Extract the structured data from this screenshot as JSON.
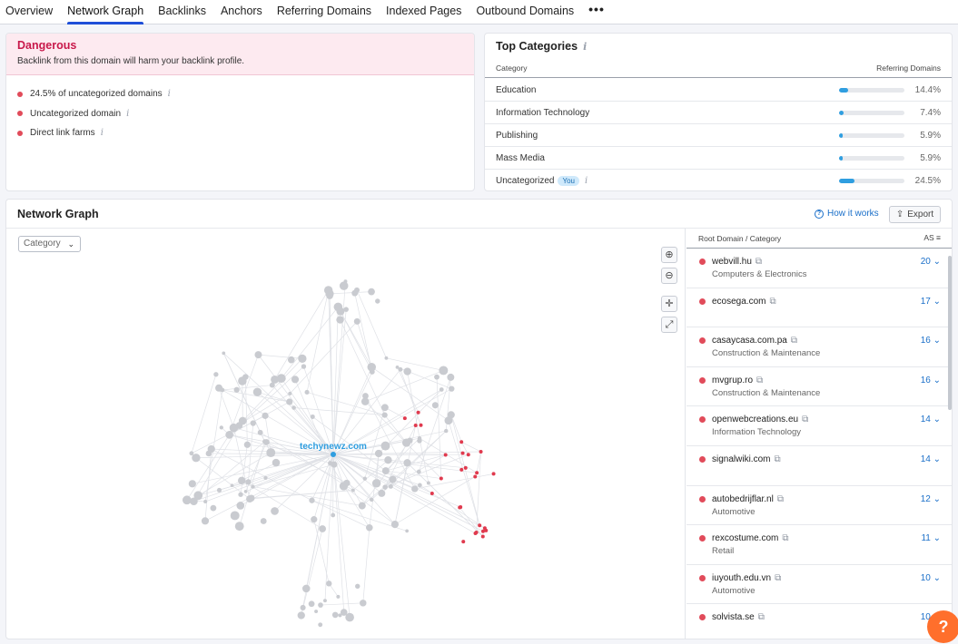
{
  "tabs": [
    {
      "label": "Overview"
    },
    {
      "label": "Network Graph",
      "active": true
    },
    {
      "label": "Backlinks"
    },
    {
      "label": "Anchors"
    },
    {
      "label": "Referring Domains"
    },
    {
      "label": "Indexed Pages"
    },
    {
      "label": "Outbound Domains"
    }
  ],
  "tabs_more": "•••",
  "danger": {
    "title": "Dangerous",
    "subtitle": "Backlink from this domain will harm your backlink profile.",
    "items": [
      {
        "label": "24.5% of uncategorized domains"
      },
      {
        "label": "Uncategorized domain"
      },
      {
        "label": "Direct link farms"
      }
    ]
  },
  "top_categories": {
    "title": "Top Categories",
    "col_category": "Category",
    "col_domains": "Referring Domains",
    "you_badge": "You",
    "rows": [
      {
        "name": "Education",
        "pct": "14.4%",
        "value": 14.4
      },
      {
        "name": "Information Technology",
        "pct": "7.4%",
        "value": 7.4
      },
      {
        "name": "Publishing",
        "pct": "5.9%",
        "value": 5.9
      },
      {
        "name": "Mass Media",
        "pct": "5.9%",
        "value": 5.9
      },
      {
        "name": "Uncategorized",
        "pct": "24.5%",
        "value": 24.5,
        "you": true
      }
    ]
  },
  "network": {
    "title": "Network Graph",
    "how_it_works": "How it works",
    "export": "Export",
    "category_select": "Category",
    "center_label": "techynewz.com",
    "colors": {
      "node": "#c9cbd0",
      "risky": "#e03a4e",
      "edge": "#dfe1e6",
      "center": "#2f9ee0"
    }
  },
  "domain_list": {
    "col_domain": "Root Domain / Category",
    "col_as": "AS",
    "rows": [
      {
        "domain": "webvill.hu",
        "category": "Computers & Electronics",
        "as": "20"
      },
      {
        "domain": "ecosega.com",
        "category": "",
        "as": "17"
      },
      {
        "domain": "casaycasa.com.pa",
        "category": "Construction & Maintenance",
        "as": "16"
      },
      {
        "domain": "mvgrup.ro",
        "category": "Construction & Maintenance",
        "as": "16"
      },
      {
        "domain": "openwebcreations.eu",
        "category": "Information Technology",
        "as": "14"
      },
      {
        "domain": "signalwiki.com",
        "category": "",
        "as": "14"
      },
      {
        "domain": "autobedrijflar.nl",
        "category": "Automotive",
        "as": "12"
      },
      {
        "domain": "rexcostume.com",
        "category": "Retail",
        "as": "11"
      },
      {
        "domain": "iuyouth.edu.vn",
        "category": "Automotive",
        "as": "10"
      },
      {
        "domain": "solvista.se",
        "category": "",
        "as": "10"
      }
    ]
  },
  "help_button": "?"
}
